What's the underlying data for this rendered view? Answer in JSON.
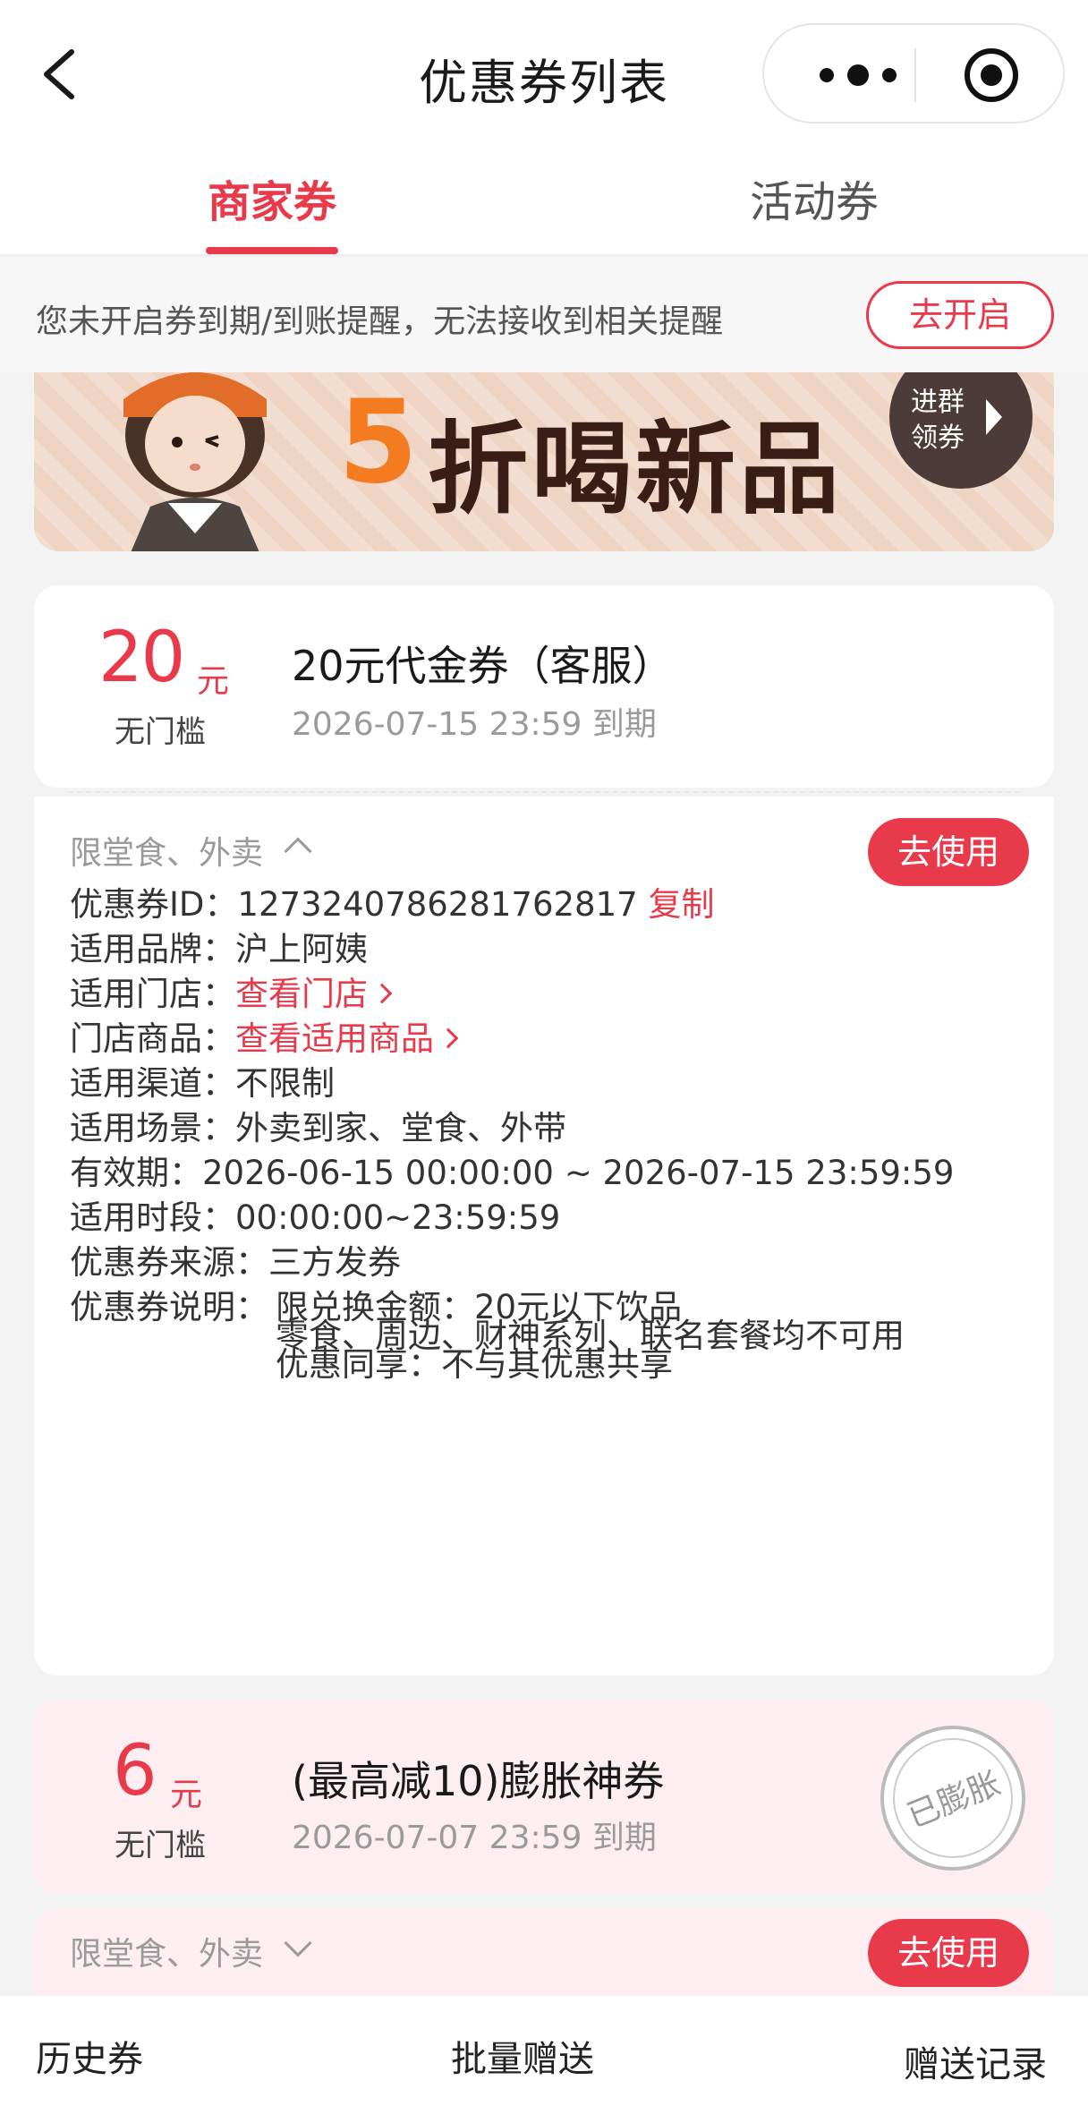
{
  "header": {
    "title": "优惠券列表",
    "back_icon": "chevron-left-icon",
    "more_icon": "more-dots-icon",
    "record_icon": "record-target-icon"
  },
  "tabs": [
    {
      "label": "商家券",
      "active": true
    },
    {
      "label": "活动券",
      "active": false
    }
  ],
  "reminder": {
    "text": "您未开启券到期/到账提醒，无法接收到相关提醒",
    "button": "去开启"
  },
  "banner": {
    "number": "5",
    "text": "折喝新品",
    "badge_line1": "进群",
    "badge_line2": "领券"
  },
  "coupons": [
    {
      "amount": "20",
      "unit": "元",
      "threshold": "无门槛",
      "title": "20元代金券（客服）",
      "expire": "2026-07-15 23:59 到期",
      "scope": "限堂食、外卖",
      "use_button": "去使用",
      "details": {
        "id_label": "优惠券ID：",
        "id_value": "1273240786281762817",
        "copy_label": "复制",
        "brand_label": "适用品牌：",
        "brand_value": "沪上阿姨",
        "store_label": "适用门店：",
        "store_link": "查看门店",
        "goods_label": "门店商品：",
        "goods_link": "查看适用商品",
        "channel_label": "适用渠道：",
        "channel_value": "不限制",
        "scene_label": "适用场景：",
        "scene_value": "外卖到家、堂食、外带",
        "valid_label": "有效期：",
        "valid_value": "2026-06-15 00:00:00 ~ 2026-07-15 23:59:59",
        "time_label": "适用时段：",
        "time_value": "00:00:00~23:59:59",
        "source_label": "优惠券来源：",
        "source_value": "三方发券",
        "desc_label": "优惠券说明：",
        "desc_lines": [
          "限兑换金额：20元以下饮品",
          "零食、周边、财神系列、联名套餐均不可用",
          "优惠同享：不与其优惠共享"
        ]
      }
    },
    {
      "amount": "6",
      "unit": "元",
      "threshold": "无门槛",
      "title": "(最高减10)膨胀神券",
      "expire": "2026-07-07 23:59 到期",
      "scope": "限堂食、外卖",
      "use_button": "去使用",
      "stamp": "已膨胀"
    }
  ],
  "bottom_bar": {
    "history": "历史券",
    "batch_gift": "批量赠送",
    "gift_record": "赠送记录"
  },
  "colors": {
    "accent": "#e83a4a",
    "banner_orange": "#f47b20",
    "banner_brown": "#3a1d14",
    "card2_bg": "#fdeff1"
  }
}
